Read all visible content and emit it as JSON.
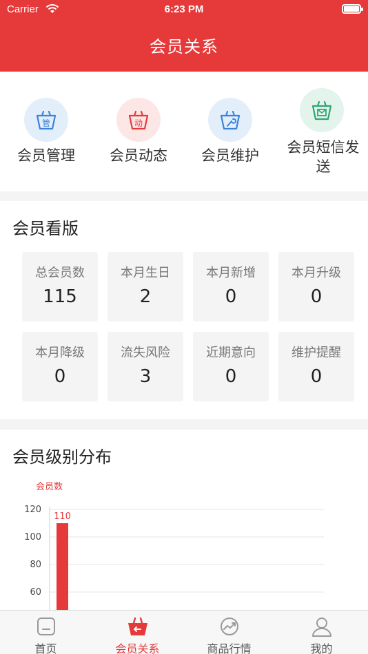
{
  "status_bar": {
    "carrier": "Carrier",
    "time": "6:23 PM"
  },
  "header": {
    "title": "会员关系"
  },
  "quick_actions": [
    {
      "label": "会员管理",
      "icon": "basket-manage-icon",
      "glyph": "管",
      "color": "#3b82d8",
      "bg": "#e3eefb"
    },
    {
      "label": "会员动态",
      "icon": "basket-dynamic-icon",
      "glyph": "动",
      "color": "#e6393a",
      "bg": "#fde6e6"
    },
    {
      "label": "会员维护",
      "icon": "basket-wrench-icon",
      "glyph": "",
      "color": "#3b82d8",
      "bg": "#e3eefb"
    },
    {
      "label": "会员短信发送",
      "icon": "basket-mail-icon",
      "glyph": "",
      "color": "#2fa673",
      "bg": "#e2f4eb"
    }
  ],
  "board": {
    "title": "会员看版",
    "cards": [
      {
        "label": "总会员数",
        "value": "115"
      },
      {
        "label": "本月生日",
        "value": "2"
      },
      {
        "label": "本月新增",
        "value": "0"
      },
      {
        "label": "本月升级",
        "value": "0"
      },
      {
        "label": "本月降级",
        "value": "0"
      },
      {
        "label": "流失风险",
        "value": "3"
      },
      {
        "label": "近期意向",
        "value": "0"
      },
      {
        "label": "维护提醒",
        "value": "0"
      }
    ]
  },
  "distribution": {
    "title": "会员级别分布"
  },
  "chart_data": {
    "type": "bar",
    "ylabel": "会员数",
    "y_ticks": [
      120,
      100,
      80,
      60
    ],
    "ylim_visible": [
      60,
      120
    ],
    "categories": [
      ""
    ],
    "values": [
      110
    ],
    "data_labels": [
      "110"
    ],
    "bar_color": "#e6393a",
    "grid": true
  },
  "tabbar": [
    {
      "label": "首页",
      "icon": "home-icon",
      "active": false
    },
    {
      "label": "会员关系",
      "icon": "member-basket-icon",
      "active": true
    },
    {
      "label": "商品行情",
      "icon": "trend-icon",
      "active": false
    },
    {
      "label": "我的",
      "icon": "profile-icon",
      "active": false
    }
  ],
  "colors": {
    "accent": "#e6393a",
    "card_bg": "#f4f4f4",
    "text_muted": "#777777"
  }
}
